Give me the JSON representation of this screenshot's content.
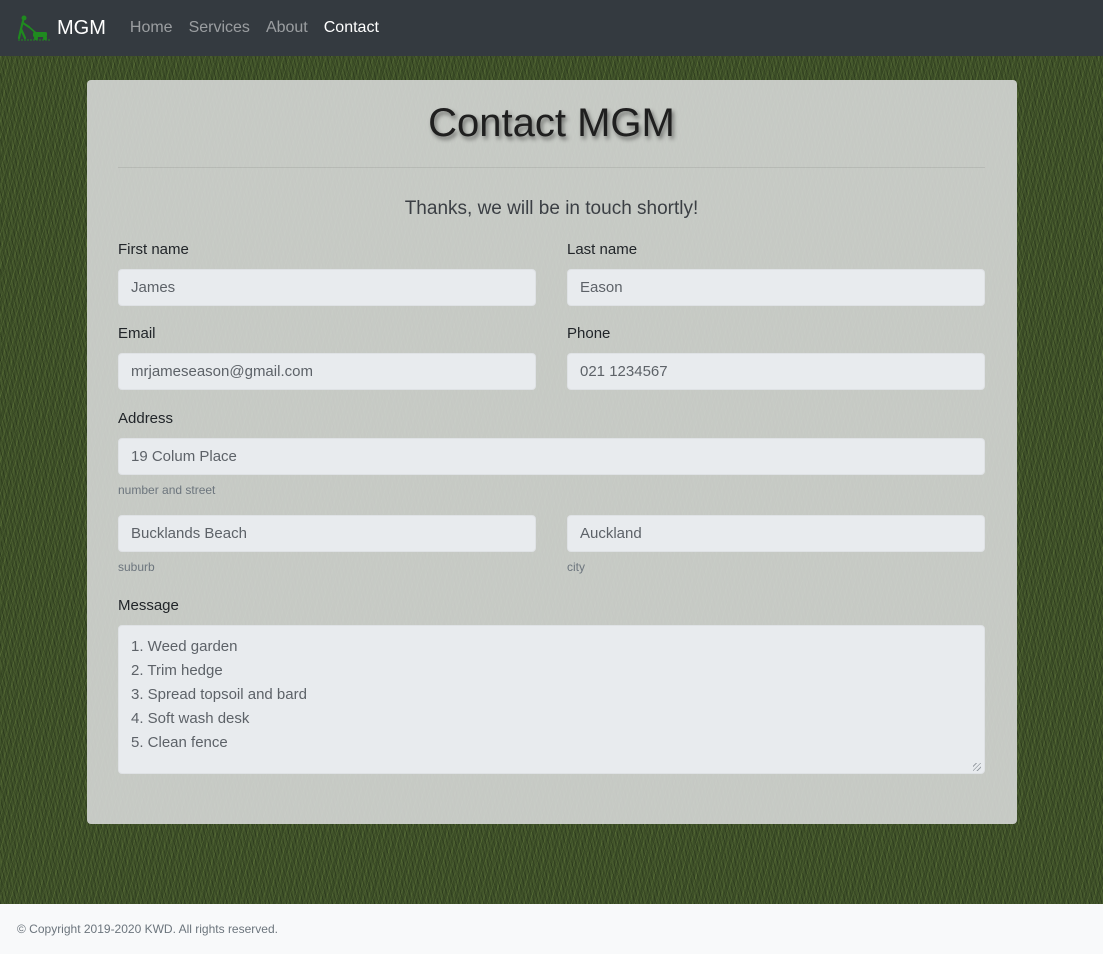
{
  "navbar": {
    "brand": "MGM",
    "logo_icon": "mower-person-icon",
    "links": [
      {
        "label": "Home",
        "active": false
      },
      {
        "label": "Services",
        "active": false
      },
      {
        "label": "About",
        "active": false
      },
      {
        "label": "Contact",
        "active": true
      }
    ]
  },
  "page": {
    "title": "Contact MGM",
    "confirmation": "Thanks, we will be in touch shortly!"
  },
  "form": {
    "first_name": {
      "label": "First name",
      "value": "James"
    },
    "last_name": {
      "label": "Last name",
      "value": "Eason"
    },
    "email": {
      "label": "Email",
      "value": "mrjameseason@gmail.com"
    },
    "phone": {
      "label": "Phone",
      "value": "021 1234567"
    },
    "address": {
      "label": "Address",
      "street": {
        "value": "19 Colum Place",
        "help": "number and street"
      },
      "suburb": {
        "value": "Bucklands Beach",
        "help": "suburb"
      },
      "city": {
        "value": "Auckland",
        "help": "city"
      }
    },
    "message": {
      "label": "Message",
      "lines": [
        "1. Weed garden",
        "2. Trim hedge",
        "3. Spread topsoil and bard",
        "4. Soft wash desk",
        "5. Clean fence"
      ]
    }
  },
  "footer": {
    "copyright": "© Copyright 2019-2020 KWD. All rights reserved."
  },
  "colors": {
    "navbar_bg": "#343a40",
    "card_bg": "#d2d5d2",
    "field_bg": "#e8ebee",
    "footer_bg": "#f8f9fa",
    "logo_green": "#1f8a1f"
  }
}
